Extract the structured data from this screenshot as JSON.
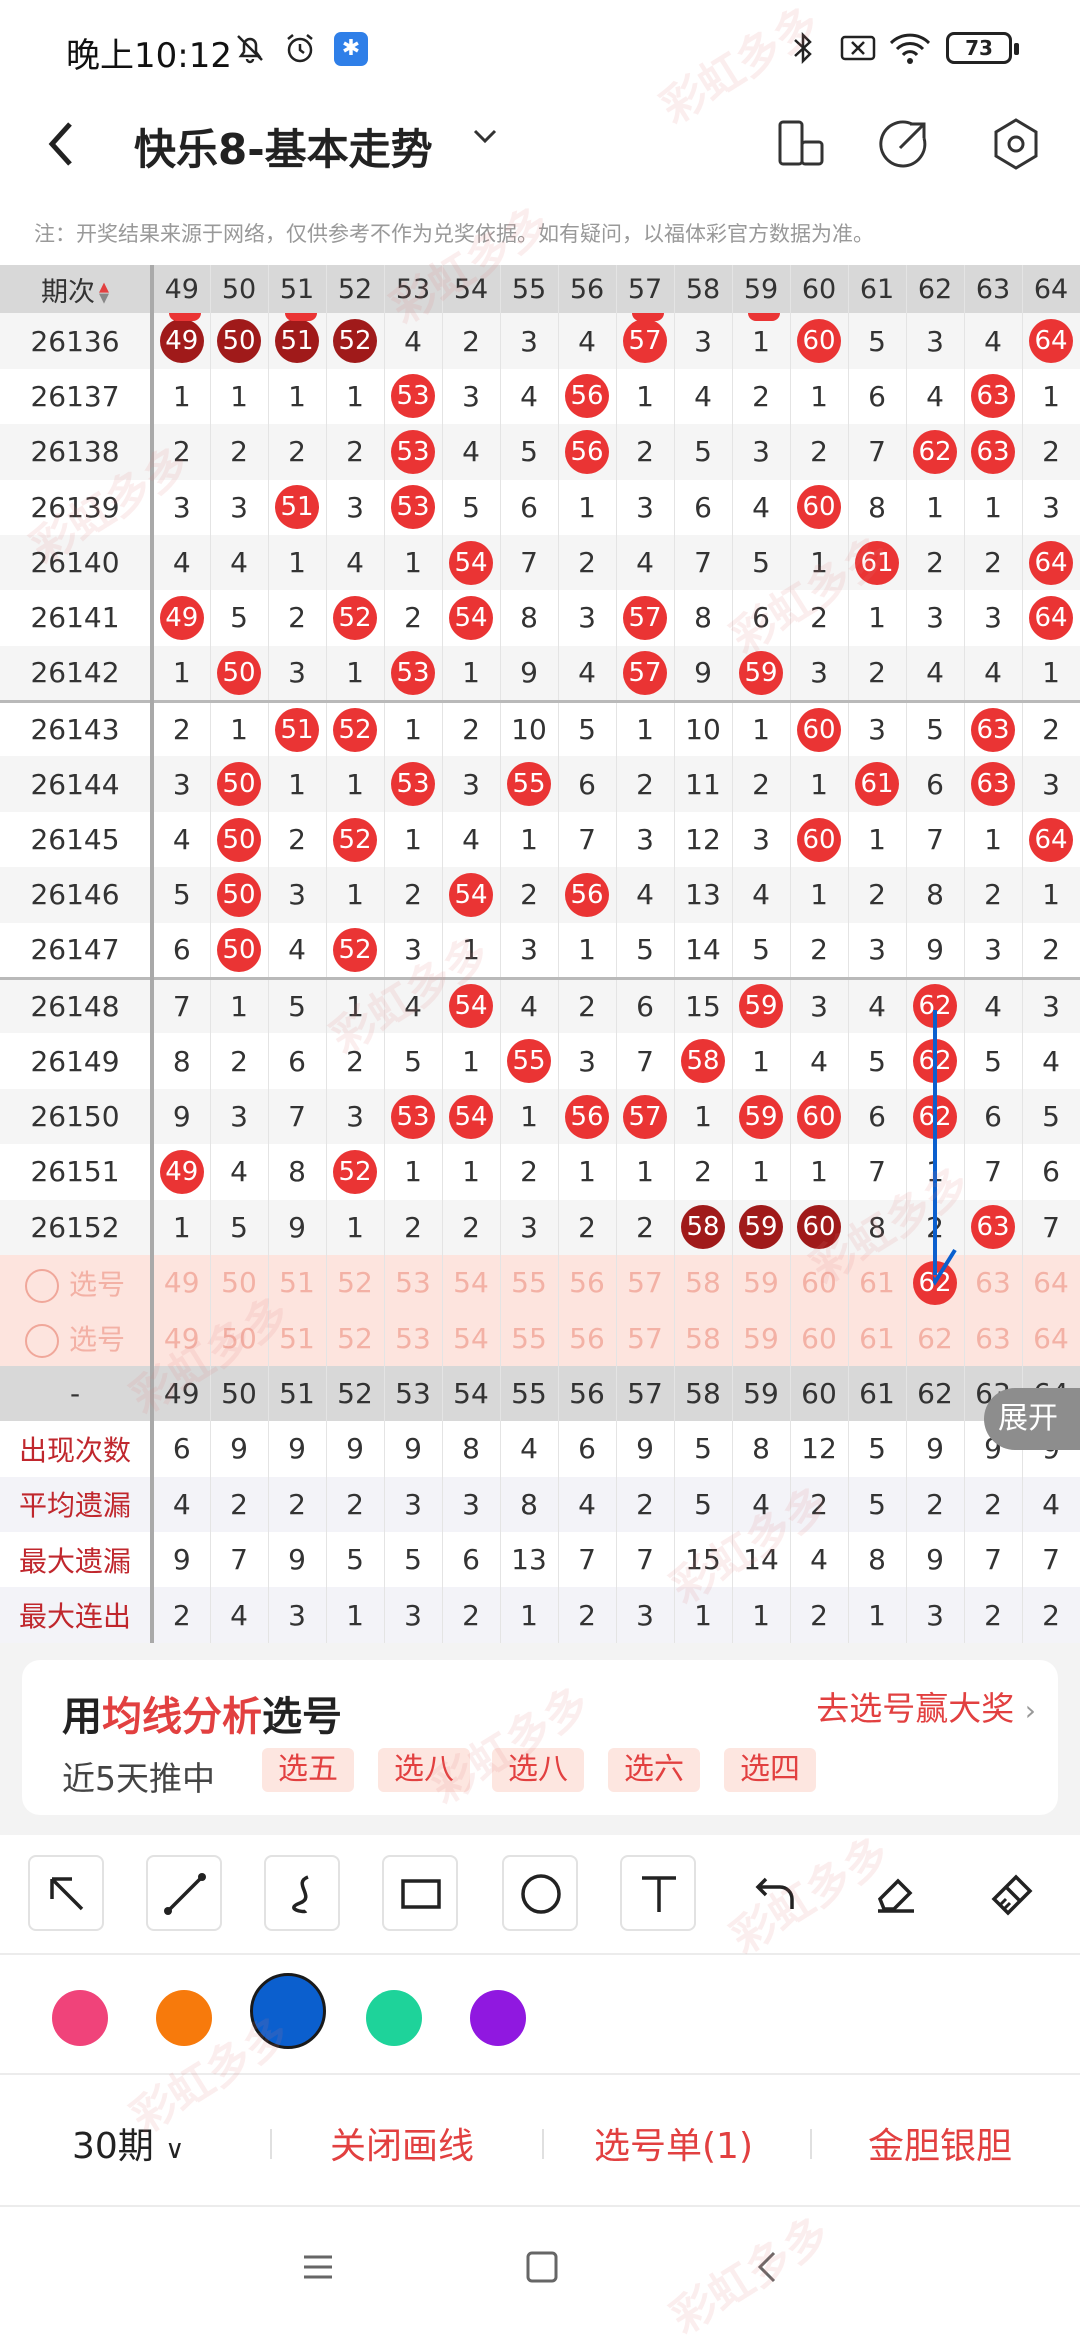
{
  "status": {
    "time": "晚上10:12",
    "battery": "73"
  },
  "nav": {
    "title": "快乐8-基本走势"
  },
  "notice": "注：开奖结果来源于网络，仅供参考不作为兑奖依据。如有疑问，以福体彩官方数据为准。",
  "table": {
    "header_label": "期次",
    "columns": [
      "49",
      "50",
      "51",
      "52",
      "53",
      "54",
      "55",
      "56",
      "57",
      "58",
      "59",
      "60",
      "61",
      "62",
      "63",
      "64"
    ],
    "rows": [
      {
        "issue": "26136",
        "cells": [
          {
            "v": "49",
            "hit": "dk"
          },
          {
            "v": "50",
            "hit": "dk"
          },
          {
            "v": "51",
            "hit": "dk"
          },
          {
            "v": "52",
            "hit": "dk"
          },
          {
            "v": "4"
          },
          {
            "v": "2"
          },
          {
            "v": "3"
          },
          {
            "v": "4"
          },
          {
            "v": "57",
            "hit": "r"
          },
          {
            "v": "3"
          },
          {
            "v": "1"
          },
          {
            "v": "60",
            "hit": "r"
          },
          {
            "v": "5"
          },
          {
            "v": "3"
          },
          {
            "v": "4"
          },
          {
            "v": "64",
            "hit": "r"
          }
        ]
      },
      {
        "issue": "26137",
        "cells": [
          {
            "v": "1"
          },
          {
            "v": "1"
          },
          {
            "v": "1"
          },
          {
            "v": "1"
          },
          {
            "v": "53",
            "hit": "r"
          },
          {
            "v": "3"
          },
          {
            "v": "4"
          },
          {
            "v": "56",
            "hit": "r"
          },
          {
            "v": "1"
          },
          {
            "v": "4"
          },
          {
            "v": "2"
          },
          {
            "v": "1"
          },
          {
            "v": "6"
          },
          {
            "v": "4"
          },
          {
            "v": "63",
            "hit": "r"
          },
          {
            "v": "1"
          }
        ]
      },
      {
        "issue": "26138",
        "cells": [
          {
            "v": "2"
          },
          {
            "v": "2"
          },
          {
            "v": "2"
          },
          {
            "v": "2"
          },
          {
            "v": "53",
            "hit": "r"
          },
          {
            "v": "4"
          },
          {
            "v": "5"
          },
          {
            "v": "56",
            "hit": "r"
          },
          {
            "v": "2"
          },
          {
            "v": "5"
          },
          {
            "v": "3"
          },
          {
            "v": "2"
          },
          {
            "v": "7"
          },
          {
            "v": "62",
            "hit": "r"
          },
          {
            "v": "63",
            "hit": "r"
          },
          {
            "v": "2"
          }
        ]
      },
      {
        "issue": "26139",
        "cells": [
          {
            "v": "3"
          },
          {
            "v": "3"
          },
          {
            "v": "51",
            "hit": "r"
          },
          {
            "v": "3"
          },
          {
            "v": "53",
            "hit": "r"
          },
          {
            "v": "5"
          },
          {
            "v": "6"
          },
          {
            "v": "1"
          },
          {
            "v": "3"
          },
          {
            "v": "6"
          },
          {
            "v": "4"
          },
          {
            "v": "60",
            "hit": "r"
          },
          {
            "v": "8"
          },
          {
            "v": "1"
          },
          {
            "v": "1"
          },
          {
            "v": "3"
          }
        ]
      },
      {
        "issue": "26140",
        "cells": [
          {
            "v": "4"
          },
          {
            "v": "4"
          },
          {
            "v": "1"
          },
          {
            "v": "4"
          },
          {
            "v": "1"
          },
          {
            "v": "54",
            "hit": "r"
          },
          {
            "v": "7"
          },
          {
            "v": "2"
          },
          {
            "v": "4"
          },
          {
            "v": "7"
          },
          {
            "v": "5"
          },
          {
            "v": "1"
          },
          {
            "v": "61",
            "hit": "r"
          },
          {
            "v": "2"
          },
          {
            "v": "2"
          },
          {
            "v": "64",
            "hit": "r"
          }
        ]
      },
      {
        "issue": "26141",
        "cells": [
          {
            "v": "49",
            "hit": "r"
          },
          {
            "v": "5"
          },
          {
            "v": "2"
          },
          {
            "v": "52",
            "hit": "r"
          },
          {
            "v": "2"
          },
          {
            "v": "54",
            "hit": "r"
          },
          {
            "v": "8"
          },
          {
            "v": "3"
          },
          {
            "v": "57",
            "hit": "r"
          },
          {
            "v": "8"
          },
          {
            "v": "6"
          },
          {
            "v": "2"
          },
          {
            "v": "1"
          },
          {
            "v": "3"
          },
          {
            "v": "3"
          },
          {
            "v": "64",
            "hit": "r"
          }
        ]
      },
      {
        "issue": "26142",
        "cells": [
          {
            "v": "1"
          },
          {
            "v": "50",
            "hit": "r"
          },
          {
            "v": "3"
          },
          {
            "v": "1"
          },
          {
            "v": "53",
            "hit": "r"
          },
          {
            "v": "1"
          },
          {
            "v": "9"
          },
          {
            "v": "4"
          },
          {
            "v": "57",
            "hit": "r"
          },
          {
            "v": "9"
          },
          {
            "v": "59",
            "hit": "r"
          },
          {
            "v": "3"
          },
          {
            "v": "2"
          },
          {
            "v": "4"
          },
          {
            "v": "4"
          },
          {
            "v": "1"
          }
        ]
      },
      {
        "issue": "26143",
        "cells": [
          {
            "v": "2"
          },
          {
            "v": "1"
          },
          {
            "v": "51",
            "hit": "r"
          },
          {
            "v": "52",
            "hit": "r"
          },
          {
            "v": "1"
          },
          {
            "v": "2"
          },
          {
            "v": "10"
          },
          {
            "v": "5"
          },
          {
            "v": "1"
          },
          {
            "v": "10"
          },
          {
            "v": "1"
          },
          {
            "v": "60",
            "hit": "r"
          },
          {
            "v": "3"
          },
          {
            "v": "5"
          },
          {
            "v": "63",
            "hit": "r"
          },
          {
            "v": "2"
          }
        ]
      },
      {
        "issue": "26144",
        "cells": [
          {
            "v": "3"
          },
          {
            "v": "50",
            "hit": "r"
          },
          {
            "v": "1"
          },
          {
            "v": "1"
          },
          {
            "v": "53",
            "hit": "r"
          },
          {
            "v": "3"
          },
          {
            "v": "55",
            "hit": "r"
          },
          {
            "v": "6"
          },
          {
            "v": "2"
          },
          {
            "v": "11"
          },
          {
            "v": "2"
          },
          {
            "v": "1"
          },
          {
            "v": "61",
            "hit": "r"
          },
          {
            "v": "6"
          },
          {
            "v": "63",
            "hit": "r"
          },
          {
            "v": "3"
          }
        ]
      },
      {
        "issue": "26145",
        "cells": [
          {
            "v": "4"
          },
          {
            "v": "50",
            "hit": "r"
          },
          {
            "v": "2"
          },
          {
            "v": "52",
            "hit": "r"
          },
          {
            "v": "1"
          },
          {
            "v": "4"
          },
          {
            "v": "1"
          },
          {
            "v": "7"
          },
          {
            "v": "3"
          },
          {
            "v": "12"
          },
          {
            "v": "3"
          },
          {
            "v": "60",
            "hit": "r"
          },
          {
            "v": "1"
          },
          {
            "v": "7"
          },
          {
            "v": "1"
          },
          {
            "v": "64",
            "hit": "r"
          }
        ]
      },
      {
        "issue": "26146",
        "cells": [
          {
            "v": "5"
          },
          {
            "v": "50",
            "hit": "r"
          },
          {
            "v": "3"
          },
          {
            "v": "1"
          },
          {
            "v": "2"
          },
          {
            "v": "54",
            "hit": "r"
          },
          {
            "v": "2"
          },
          {
            "v": "56",
            "hit": "r"
          },
          {
            "v": "4"
          },
          {
            "v": "13"
          },
          {
            "v": "4"
          },
          {
            "v": "1"
          },
          {
            "v": "2"
          },
          {
            "v": "8"
          },
          {
            "v": "2"
          },
          {
            "v": "1"
          }
        ]
      },
      {
        "issue": "26147",
        "cells": [
          {
            "v": "6"
          },
          {
            "v": "50",
            "hit": "r"
          },
          {
            "v": "4"
          },
          {
            "v": "52",
            "hit": "r"
          },
          {
            "v": "3"
          },
          {
            "v": "1"
          },
          {
            "v": "3"
          },
          {
            "v": "1"
          },
          {
            "v": "5"
          },
          {
            "v": "14"
          },
          {
            "v": "5"
          },
          {
            "v": "2"
          },
          {
            "v": "3"
          },
          {
            "v": "9"
          },
          {
            "v": "3"
          },
          {
            "v": "2"
          }
        ]
      },
      {
        "issue": "26148",
        "cells": [
          {
            "v": "7"
          },
          {
            "v": "1"
          },
          {
            "v": "5"
          },
          {
            "v": "1"
          },
          {
            "v": "4"
          },
          {
            "v": "54",
            "hit": "r"
          },
          {
            "v": "4"
          },
          {
            "v": "2"
          },
          {
            "v": "6"
          },
          {
            "v": "15"
          },
          {
            "v": "59",
            "hit": "r"
          },
          {
            "v": "3"
          },
          {
            "v": "4"
          },
          {
            "v": "62",
            "hit": "r"
          },
          {
            "v": "4"
          },
          {
            "v": "3"
          }
        ]
      },
      {
        "issue": "26149",
        "cells": [
          {
            "v": "8"
          },
          {
            "v": "2"
          },
          {
            "v": "6"
          },
          {
            "v": "2"
          },
          {
            "v": "5"
          },
          {
            "v": "1"
          },
          {
            "v": "55",
            "hit": "r"
          },
          {
            "v": "3"
          },
          {
            "v": "7"
          },
          {
            "v": "58",
            "hit": "r"
          },
          {
            "v": "1"
          },
          {
            "v": "4"
          },
          {
            "v": "5"
          },
          {
            "v": "62",
            "hit": "r"
          },
          {
            "v": "5"
          },
          {
            "v": "4"
          }
        ]
      },
      {
        "issue": "26150",
        "cells": [
          {
            "v": "9"
          },
          {
            "v": "3"
          },
          {
            "v": "7"
          },
          {
            "v": "3"
          },
          {
            "v": "53",
            "hit": "r"
          },
          {
            "v": "54",
            "hit": "r"
          },
          {
            "v": "1"
          },
          {
            "v": "56",
            "hit": "r"
          },
          {
            "v": "57",
            "hit": "r"
          },
          {
            "v": "1"
          },
          {
            "v": "59",
            "hit": "r"
          },
          {
            "v": "60",
            "hit": "r"
          },
          {
            "v": "6"
          },
          {
            "v": "62",
            "hit": "r"
          },
          {
            "v": "6"
          },
          {
            "v": "5"
          }
        ]
      },
      {
        "issue": "26151",
        "cells": [
          {
            "v": "49",
            "hit": "r"
          },
          {
            "v": "4"
          },
          {
            "v": "8"
          },
          {
            "v": "52",
            "hit": "r"
          },
          {
            "v": "1"
          },
          {
            "v": "1"
          },
          {
            "v": "2"
          },
          {
            "v": "1"
          },
          {
            "v": "1"
          },
          {
            "v": "2"
          },
          {
            "v": "1"
          },
          {
            "v": "1"
          },
          {
            "v": "7"
          },
          {
            "v": "1"
          },
          {
            "v": "7"
          },
          {
            "v": "6"
          }
        ]
      },
      {
        "issue": "26152",
        "cells": [
          {
            "v": "1"
          },
          {
            "v": "5"
          },
          {
            "v": "9"
          },
          {
            "v": "1"
          },
          {
            "v": "2"
          },
          {
            "v": "2"
          },
          {
            "v": "3"
          },
          {
            "v": "2"
          },
          {
            "v": "2"
          },
          {
            "v": "58",
            "hit": "dk"
          },
          {
            "v": "59",
            "hit": "dk"
          },
          {
            "v": "60",
            "hit": "dk"
          },
          {
            "v": "8"
          },
          {
            "v": "2"
          },
          {
            "v": "63",
            "hit": "r"
          },
          {
            "v": "7"
          }
        ]
      }
    ],
    "pick_rows": [
      {
        "label": "选号",
        "selected": "62"
      },
      {
        "label": "选号",
        "selected": ""
      }
    ],
    "footer_label": "-",
    "expand_label": "展开",
    "stats": [
      {
        "label": "出现次数",
        "color": "c-red",
        "values": [
          "6",
          "9",
          "9",
          "9",
          "9",
          "8",
          "4",
          "6",
          "9",
          "5",
          "8",
          "12",
          "5",
          "9",
          "9",
          "9"
        ]
      },
      {
        "label": "平均遗漏",
        "color": "c-brown",
        "values": [
          "4",
          "2",
          "2",
          "2",
          "3",
          "3",
          "8",
          "4",
          "2",
          "5",
          "4",
          "2",
          "5",
          "2",
          "2",
          "4"
        ]
      },
      {
        "label": "最大遗漏",
        "color": "c-blue",
        "values": [
          "9",
          "7",
          "9",
          "5",
          "5",
          "6",
          "13",
          "7",
          "7",
          "15",
          "14",
          "4",
          "8",
          "9",
          "7",
          "7"
        ]
      },
      {
        "label": "最大连出",
        "color": "c-brown",
        "values": [
          "2",
          "4",
          "3",
          "1",
          "3",
          "2",
          "1",
          "2",
          "3",
          "1",
          "1",
          "2",
          "1",
          "3",
          "2",
          "2"
        ]
      }
    ]
  },
  "promo": {
    "title_prefix": "用",
    "title_highlight": "均线分析",
    "title_suffix": "选号",
    "cta": "去选号赢大奖",
    "sub": "近5天推中",
    "tags": [
      "选五",
      "选八",
      "选八",
      "选六",
      "选四"
    ]
  },
  "draw_tools": [
    "arrow-tool-icon",
    "line-tool-icon",
    "curve-tool-icon",
    "rectangle-tool-icon",
    "circle-tool-icon",
    "text-tool-icon",
    "undo-icon",
    "eraser-icon",
    "clear-brush-icon"
  ],
  "palette": [
    "#f0437a",
    "#f77a0c",
    "#0b5fce",
    "#1ed39a",
    "#9018e0"
  ],
  "palette_selected": "#0b5fce",
  "bottom": {
    "periods": "30期",
    "close_draw": "关闭画线",
    "pick_list": "选号单(1)",
    "gold_silver": "金胆银胆"
  },
  "watermark": "彩虹多多"
}
